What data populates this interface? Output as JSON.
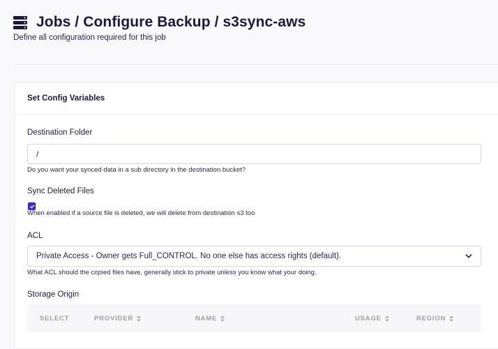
{
  "header": {
    "title": "Jobs / Configure Backup / s3sync-aws",
    "subtitle": "Define all configuration required for this job"
  },
  "card": {
    "title": "Set Config Variables",
    "destination": {
      "label": "Destination Folder",
      "value": "/",
      "help": "Do you want your synced data in a sub directory in the destination bucket?"
    },
    "sync_deleted": {
      "label": "Sync Deleted Files",
      "checked": true,
      "help": "When enabled if a source file is deleted, we will delete from destination s3 too"
    },
    "acl": {
      "label": "ACL",
      "selected": "Private Access - Owner gets Full_CONTROL. No one else has access rights (default).",
      "help": "What ACL should the copied files have, generally stick to private unless you know what your doing."
    },
    "storage_origin": {
      "label": "Storage Origin",
      "columns": [
        "SELECT",
        "PROVIDER",
        "NAME",
        "USAGE",
        "REGION"
      ]
    }
  },
  "colors": {
    "accent": "#3b30c9",
    "title": "#1b1a3c",
    "muted": "#9c9cb0"
  },
  "icons": {
    "title_icon": "server-icon",
    "select_icon": "chevron-down-icon",
    "sort_icon": "sort-icon"
  }
}
